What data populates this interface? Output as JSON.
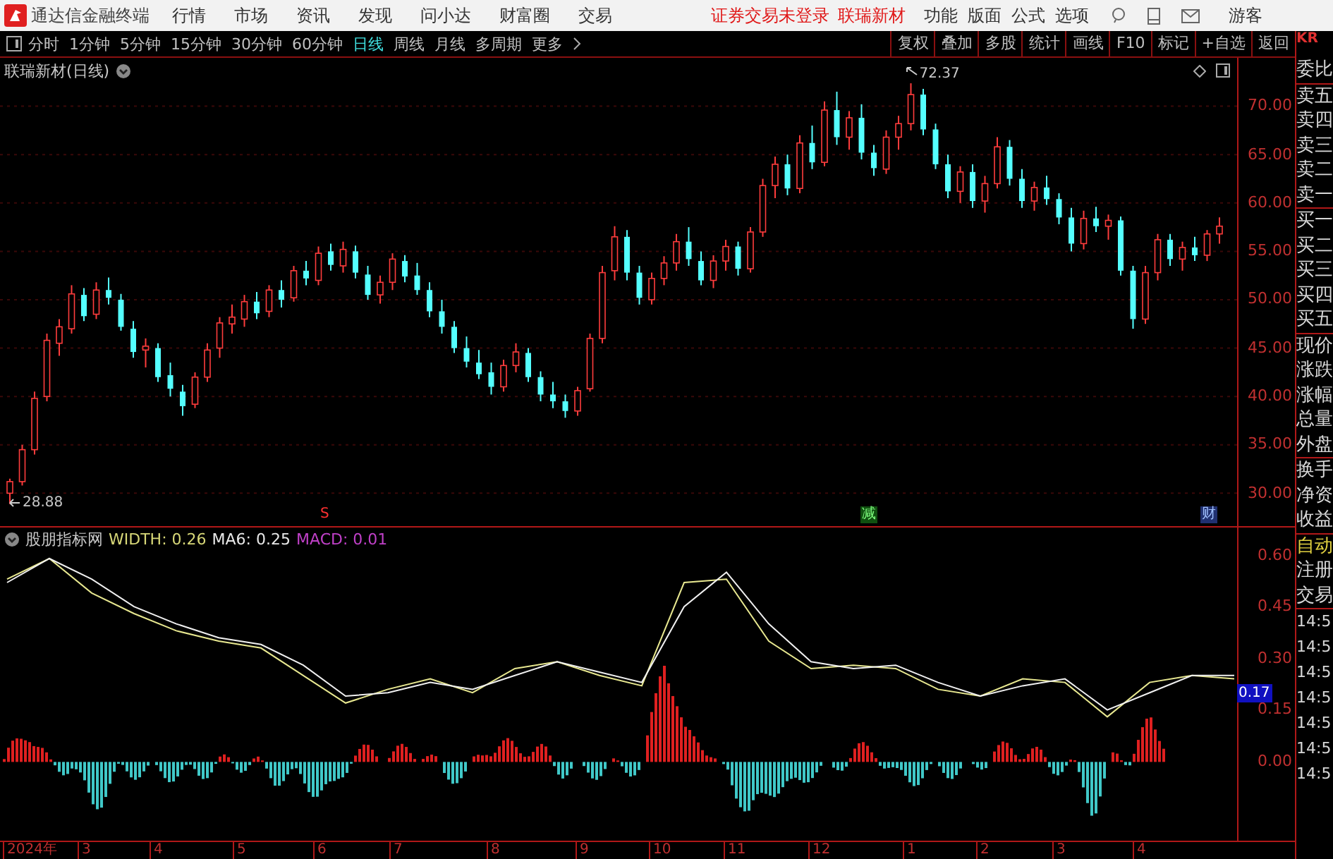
{
  "app": {
    "title": "通达信金融终端"
  },
  "menu": [
    "行情",
    "市场",
    "资讯",
    "发现",
    "问小达",
    "财富圈",
    "交易"
  ],
  "login_status": "证券交易未登录",
  "stock_name": "联瑞新材",
  "right_menu": [
    "功能",
    "版面",
    "公式",
    "选项"
  ],
  "user": "游客",
  "periods": [
    {
      "label": "分时",
      "selected": false
    },
    {
      "label": "1分钟",
      "selected": false
    },
    {
      "label": "5分钟",
      "selected": false
    },
    {
      "label": "15分钟",
      "selected": false
    },
    {
      "label": "30分钟",
      "selected": false
    },
    {
      "label": "60分钟",
      "selected": false
    },
    {
      "label": "日线",
      "selected": true
    },
    {
      "label": "周线",
      "selected": false
    },
    {
      "label": "月线",
      "selected": false
    },
    {
      "label": "多周期",
      "selected": false
    }
  ],
  "period_more": "更多",
  "tools": [
    "复权",
    "叠加",
    "多股",
    "统计",
    "画线",
    "F10",
    "标记",
    "+自选",
    "返回"
  ],
  "code_badge": "KR",
  "chart": {
    "title": "联瑞新材(日线)",
    "high_label": "72.37",
    "low_label": "28.88",
    "chart_data": {
      "type": "candlestick",
      "ylim": [
        26.6,
        75
      ],
      "grid": true,
      "yticks": [
        {
          "value": 70,
          "label": "70.00"
        },
        {
          "value": 65,
          "label": "65.00"
        },
        {
          "value": 60,
          "label": "60.00"
        },
        {
          "value": 55,
          "label": "55.00"
        },
        {
          "value": 50,
          "label": "50.00"
        },
        {
          "value": 45,
          "label": "45.00"
        },
        {
          "value": 40,
          "label": "40.00"
        },
        {
          "value": 35,
          "label": "35.00"
        },
        {
          "value": 30,
          "label": "30.00"
        }
      ],
      "ohlc": [
        [
          30.0,
          31.5,
          28.88,
          31.2
        ],
        [
          31.2,
          35.0,
          30.8,
          34.5
        ],
        [
          34.5,
          40.5,
          34.0,
          39.8
        ],
        [
          40.0,
          46.5,
          39.5,
          45.8
        ],
        [
          45.5,
          48.0,
          44.2,
          47.2
        ],
        [
          47.0,
          51.5,
          46.5,
          50.6
        ],
        [
          50.5,
          51.2,
          47.8,
          48.3
        ],
        [
          48.5,
          51.8,
          48.0,
          51.0
        ],
        [
          51.0,
          52.3,
          49.5,
          50.2
        ],
        [
          50.0,
          50.6,
          46.8,
          47.2
        ],
        [
          47.0,
          47.8,
          44.0,
          44.6
        ],
        [
          44.8,
          46.0,
          43.0,
          45.2
        ],
        [
          45.0,
          45.5,
          41.5,
          42.0
        ],
        [
          42.2,
          43.5,
          40.0,
          40.8
        ],
        [
          40.5,
          41.2,
          38.0,
          39.0
        ],
        [
          39.2,
          42.5,
          38.8,
          42.0
        ],
        [
          42.0,
          45.5,
          41.5,
          44.8
        ],
        [
          45.0,
          48.2,
          44.0,
          47.6
        ],
        [
          47.5,
          49.5,
          46.5,
          48.2
        ],
        [
          48.0,
          50.5,
          47.2,
          49.8
        ],
        [
          49.8,
          50.8,
          48.0,
          48.6
        ],
        [
          48.8,
          51.5,
          48.2,
          51.0
        ],
        [
          51.0,
          52.0,
          49.2,
          50.0
        ],
        [
          50.2,
          53.5,
          49.8,
          53.0
        ],
        [
          53.0,
          54.0,
          51.5,
          52.2
        ],
        [
          52.0,
          55.5,
          51.5,
          54.8
        ],
        [
          55.0,
          55.8,
          53.0,
          53.6
        ],
        [
          53.5,
          56.0,
          52.8,
          55.2
        ],
        [
          55.0,
          55.6,
          52.2,
          52.8
        ],
        [
          52.6,
          53.5,
          50.0,
          50.5
        ],
        [
          50.5,
          52.5,
          49.6,
          51.8
        ],
        [
          51.8,
          54.8,
          51.0,
          54.2
        ],
        [
          54.0,
          54.6,
          51.8,
          52.4
        ],
        [
          52.5,
          53.8,
          50.5,
          51.0
        ],
        [
          51.0,
          51.8,
          48.2,
          48.8
        ],
        [
          48.8,
          50.0,
          46.5,
          47.2
        ],
        [
          47.2,
          47.8,
          44.5,
          45.0
        ],
        [
          45.0,
          46.2,
          43.0,
          43.6
        ],
        [
          43.5,
          44.8,
          41.8,
          42.3
        ],
        [
          42.5,
          43.5,
          40.2,
          41.0
        ],
        [
          41.0,
          43.8,
          40.5,
          43.2
        ],
        [
          43.2,
          45.5,
          42.5,
          44.6
        ],
        [
          44.5,
          45.0,
          41.5,
          42.0
        ],
        [
          42.0,
          42.6,
          39.5,
          40.2
        ],
        [
          40.2,
          41.5,
          38.8,
          39.5
        ],
        [
          39.5,
          40.2,
          37.8,
          38.5
        ],
        [
          38.5,
          41.0,
          38.0,
          40.6
        ],
        [
          40.8,
          46.5,
          40.5,
          46.0
        ],
        [
          46.0,
          53.5,
          45.5,
          52.8
        ],
        [
          53.0,
          57.6,
          52.0,
          56.5
        ],
        [
          56.5,
          57.2,
          52.0,
          52.8
        ],
        [
          52.8,
          53.5,
          49.5,
          50.2
        ],
        [
          50.0,
          52.8,
          49.5,
          52.2
        ],
        [
          52.2,
          54.5,
          51.5,
          53.8
        ],
        [
          53.8,
          56.8,
          53.0,
          56.0
        ],
        [
          56.0,
          57.5,
          53.5,
          54.2
        ],
        [
          54.0,
          55.0,
          51.5,
          52.0
        ],
        [
          52.0,
          54.6,
          51.2,
          54.0
        ],
        [
          54.0,
          56.2,
          53.0,
          55.5
        ],
        [
          55.5,
          56.0,
          52.5,
          53.2
        ],
        [
          53.2,
          57.5,
          52.8,
          57.0
        ],
        [
          57.0,
          62.5,
          56.5,
          61.8
        ],
        [
          61.8,
          64.8,
          60.5,
          64.0
        ],
        [
          64.0,
          65.0,
          60.8,
          61.5
        ],
        [
          61.5,
          67.0,
          61.0,
          66.2
        ],
        [
          66.2,
          68.0,
          63.5,
          64.2
        ],
        [
          64.2,
          70.5,
          63.8,
          69.6
        ],
        [
          69.6,
          71.5,
          66.0,
          66.8
        ],
        [
          66.8,
          69.5,
          65.5,
          68.8
        ],
        [
          68.8,
          70.2,
          64.5,
          65.2
        ],
        [
          65.2,
          66.0,
          62.8,
          63.6
        ],
        [
          63.5,
          67.5,
          63.0,
          66.8
        ],
        [
          66.8,
          69.0,
          65.5,
          68.2
        ],
        [
          68.2,
          72.37,
          67.5,
          71.2
        ],
        [
          71.2,
          71.8,
          67.0,
          67.6
        ],
        [
          67.6,
          68.2,
          63.5,
          64.0
        ],
        [
          64.0,
          65.0,
          60.5,
          61.2
        ],
        [
          61.2,
          63.8,
          60.0,
          63.2
        ],
        [
          63.2,
          64.0,
          59.5,
          60.2
        ],
        [
          60.2,
          62.8,
          59.0,
          62.0
        ],
        [
          62.0,
          66.8,
          61.5,
          65.8
        ],
        [
          65.8,
          66.5,
          61.8,
          62.5
        ],
        [
          62.5,
          63.5,
          59.5,
          60.2
        ],
        [
          60.2,
          62.2,
          59.2,
          61.6
        ],
        [
          61.6,
          62.8,
          59.8,
          60.4
        ],
        [
          60.4,
          61.0,
          57.8,
          58.5
        ],
        [
          58.5,
          59.5,
          55.0,
          55.8
        ],
        [
          55.8,
          59.2,
          55.2,
          58.4
        ],
        [
          58.4,
          59.6,
          57.0,
          57.6
        ],
        [
          57.6,
          58.8,
          56.2,
          58.2
        ],
        [
          58.2,
          58.6,
          52.5,
          53.0
        ],
        [
          53.0,
          53.5,
          47.0,
          48.0
        ],
        [
          48.0,
          53.5,
          47.5,
          52.8
        ],
        [
          52.8,
          56.8,
          52.0,
          56.2
        ],
        [
          56.2,
          56.8,
          53.5,
          54.2
        ],
        [
          54.2,
          56.0,
          53.0,
          55.4
        ],
        [
          55.4,
          56.5,
          54.0,
          54.6
        ],
        [
          54.6,
          57.2,
          54.0,
          56.8
        ],
        [
          56.8,
          58.5,
          55.8,
          57.6
        ]
      ]
    },
    "events": [
      {
        "kind": "signal",
        "text": "S"
      },
      {
        "kind": "reduce",
        "text": "减"
      },
      {
        "kind": "finance",
        "text": "财"
      }
    ]
  },
  "indicator": {
    "name": "股朋指标网",
    "values": [
      {
        "label": "WIDTH: 0.26",
        "color": "#d8d878"
      },
      {
        "label": "MA6: 0.25",
        "color": "#e8e8e8"
      },
      {
        "label": "MACD: 0.01",
        "color": "#c040c8"
      }
    ],
    "chart_data": {
      "type": "line",
      "ylim": [
        -0.23,
        0.68
      ],
      "yticks": [
        {
          "value": 0.6,
          "label": "0.60"
        },
        {
          "value": 0.45,
          "label": "0.45"
        },
        {
          "value": 0.3,
          "label": "0.30"
        },
        {
          "value": 0.15,
          "label": "0.15"
        },
        {
          "value": 0,
          "label": "0.00"
        }
      ],
      "series": [
        {
          "color": "#e8e890",
          "values": [
            0.53,
            0.59,
            0.49,
            0.43,
            0.38,
            0.35,
            0.33,
            0.25,
            0.17,
            0.21,
            0.24,
            0.2,
            0.27,
            0.29,
            0.25,
            0.22,
            0.52,
            0.53,
            0.35,
            0.27,
            0.28,
            0.27,
            0.21,
            0.19,
            0.24,
            0.23,
            0.13,
            0.23,
            0.25,
            0.24
          ]
        },
        {
          "color": "#f0f0f0",
          "values": [
            0.52,
            0.59,
            0.53,
            0.45,
            0.4,
            0.36,
            0.34,
            0.28,
            0.19,
            0.2,
            0.23,
            0.21,
            0.25,
            0.29,
            0.26,
            0.23,
            0.45,
            0.55,
            0.4,
            0.29,
            0.27,
            0.28,
            0.23,
            0.19,
            0.22,
            0.24,
            0.15,
            0.2,
            0.25,
            0.25
          ]
        }
      ]
    },
    "cursor_value": "0.17"
  },
  "date_axis": [
    "2024年",
    "3",
    "4",
    "5",
    "6",
    "7",
    "8",
    "9",
    "10",
    "11",
    "12",
    "1",
    "2",
    "3",
    "4"
  ],
  "quote_panel": {
    "groups": [
      [
        "委比"
      ],
      [
        "卖五",
        "卖四",
        "卖三",
        "卖二",
        "卖一"
      ],
      [
        "买一",
        "买二",
        "买三",
        "买四",
        "买五"
      ],
      [
        "现价",
        "涨跌",
        "涨幅",
        "总量",
        "外盘"
      ],
      [
        "换手",
        "净资",
        "收益"
      ]
    ],
    "actions": [
      {
        "text": "自动",
        "kind": "highlight"
      },
      {
        "text": "注册",
        "kind": "plain"
      },
      {
        "text": "交易",
        "kind": "plain"
      }
    ],
    "times": [
      "14:5",
      "14:5",
      "14:5",
      "14:5",
      "14:5",
      "14:5",
      "14:5"
    ]
  }
}
